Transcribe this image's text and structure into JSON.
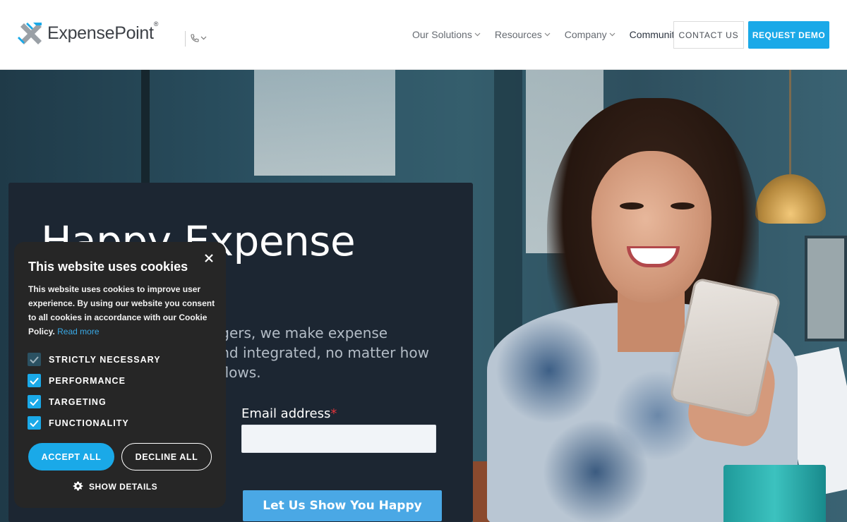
{
  "header": {
    "logo": {
      "name": "ExpensePoint",
      "registered": "®"
    },
    "nav": [
      {
        "label": "Our Solutions"
      },
      {
        "label": "Resources"
      },
      {
        "label": "Company"
      },
      {
        "label": "Community"
      }
    ],
    "contact_label": "CONTACT US",
    "demo_label": "REQUEST DEMO"
  },
  "hero": {
    "title": "Happy Expense",
    "subtitle_lines": [
      "agers, we make expense",
      "and integrated, no matter how",
      "kflows."
    ],
    "email_label": "Email address",
    "email_required": "*",
    "email_value": "",
    "cta_label": "Let Us Show You Happy"
  },
  "cookie": {
    "title": "This website uses cookies",
    "text_lines": [
      "This website uses cookies to improve user",
      "experience. By using our website you consent",
      "to all cookies in accordance with our Cookie"
    ],
    "text_last": "Policy.",
    "read_more": "Read more",
    "options": [
      {
        "label": "STRICTLY NECESSARY",
        "checked": true,
        "disabled": true
      },
      {
        "label": "PERFORMANCE",
        "checked": true,
        "disabled": false
      },
      {
        "label": "TARGETING",
        "checked": true,
        "disabled": false
      },
      {
        "label": "FUNCTIONALITY",
        "checked": true,
        "disabled": false
      }
    ],
    "accept_label": "ACCEPT ALL",
    "decline_label": "DECLINE ALL",
    "details_label": "SHOW DETAILS"
  },
  "colors": {
    "accent": "#1aa9e8",
    "panel": "#1c2632",
    "cookie_bg": "#262626",
    "cta": "#4aa8e5",
    "required": "#e2343b"
  }
}
